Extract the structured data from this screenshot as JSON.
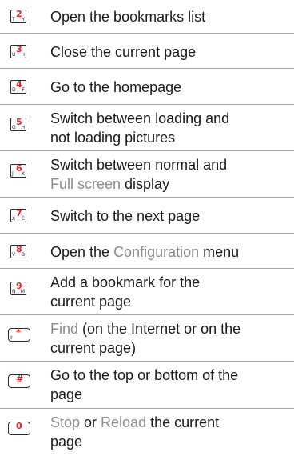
{
  "rows": [
    {
      "key": {
        "main": "2",
        "left": "T",
        "right": "Y"
      },
      "text": "Open the bookmarks list"
    },
    {
      "key": {
        "main": "3",
        "left": "U",
        "right": "I"
      },
      "text": "Close the current page"
    },
    {
      "key": {
        "main": "4",
        "left": "D",
        "right": "F"
      },
      "text": "Go to the homepage"
    },
    {
      "key": {
        "main": "5",
        "left": "G",
        "right": "H"
      },
      "text_1": "Switch between loading and",
      "text_2": "not loading pictures"
    },
    {
      "key": {
        "main": "6",
        "left": "J",
        "right": "K"
      },
      "text_1": "Switch between normal and",
      "text_2_hl": "Full screen",
      "text_2_rest": " display"
    },
    {
      "key": {
        "main": "7",
        "left": "X",
        "right": "C"
      },
      "text": "Switch to the next page"
    },
    {
      "key": {
        "main": "8",
        "left": "V",
        "right": "B"
      },
      "text_pre": "Open the ",
      "text_hl": "Configuration",
      "text_post": " menu"
    },
    {
      "key": {
        "main": "9",
        "left": "N",
        "right": "M"
      },
      "text_1": "Add a bookmark for the",
      "text_2": "current page"
    },
    {
      "key": {
        "main": "*",
        "left": "⇧",
        "right": ""
      },
      "text_hl": "Find",
      "text_1_rest": " (on the Internet or on the",
      "text_2": "current page)"
    },
    {
      "key": {
        "main": "#",
        "left": "",
        "right": ""
      },
      "text_1": "Go to the top or bottom of the",
      "text_2": "page"
    },
    {
      "key": {
        "main": "0",
        "left": "",
        "right": ""
      },
      "text_hl_a": "Stop",
      "text_mid": " or ",
      "text_hl_b": "Reload",
      "text_1_rest": " the current",
      "text_2": "page"
    }
  ]
}
